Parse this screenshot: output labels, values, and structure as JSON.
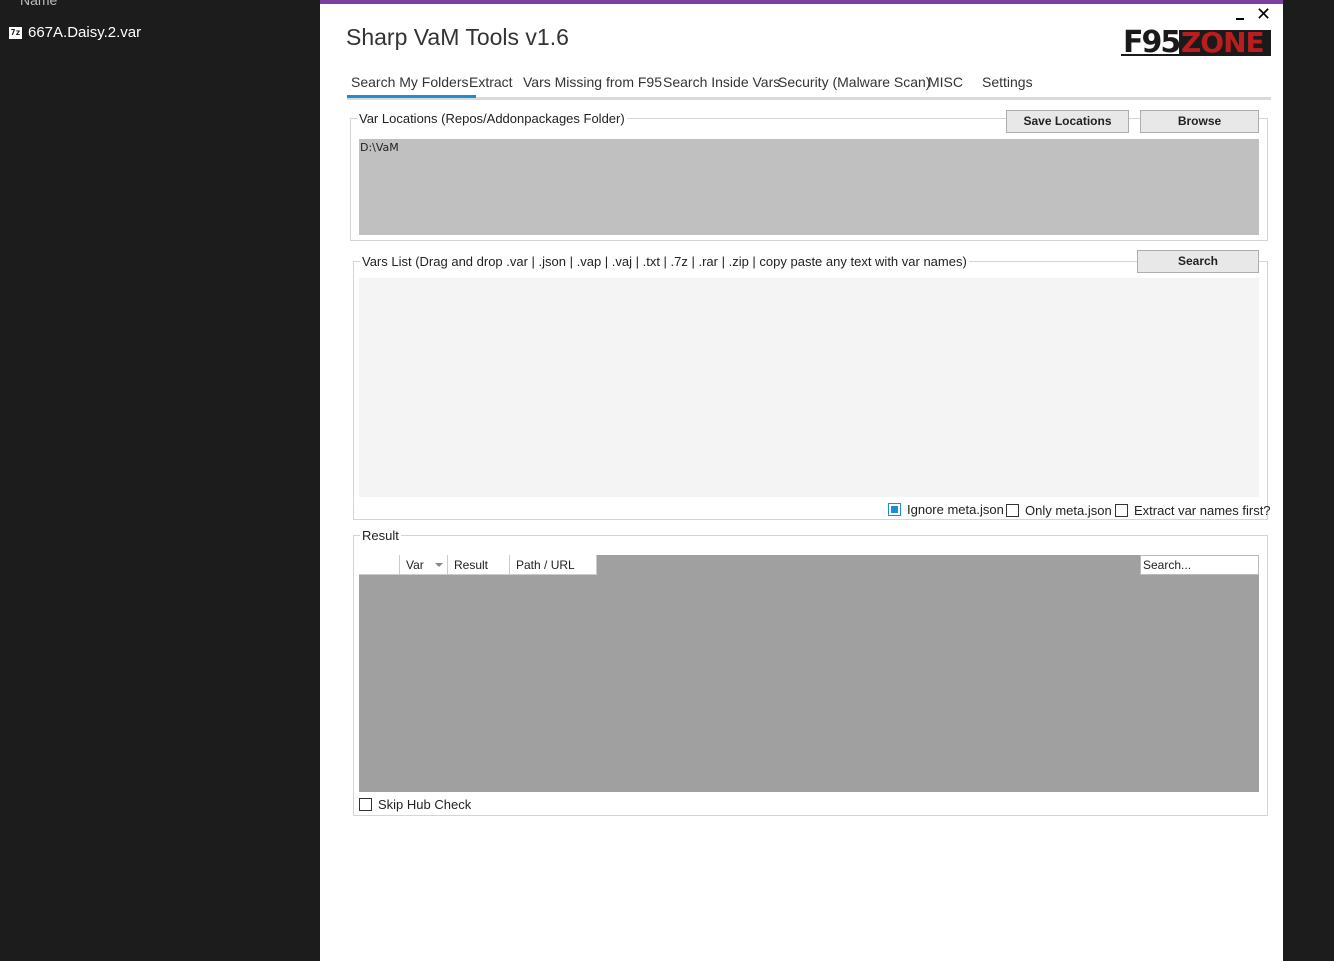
{
  "explorer": {
    "header": "Name",
    "file_name": "667A.Daisy.2.var",
    "file_icon": "7z"
  },
  "app": {
    "title": "Sharp VaM Tools v1.6",
    "accent_color": "#7b3fa0",
    "logo_text_a": "F95",
    "logo_text_b": "ZONE",
    "close_glyph": "✕"
  },
  "tabs": [
    {
      "label": "Search My Folders",
      "active": true
    },
    {
      "label": "Extract"
    },
    {
      "label": "Vars Missing from F95"
    },
    {
      "label": "Search Inside Vars"
    },
    {
      "label": "Security (Malware Scan)"
    },
    {
      "label": "MISC"
    },
    {
      "label": "Settings"
    }
  ],
  "locations": {
    "label": "Var Locations (Repos/Addonpackages Folder)",
    "save_button": "Save Locations",
    "browse_button": "Browse",
    "value": "D:\\VaM"
  },
  "vars_list": {
    "label": "Vars List (Drag and drop .var | .json | .vap | .vaj | .txt | .7z | .rar | .zip | copy paste any text with var names)",
    "search_button": "Search",
    "ignore_meta": "Ignore meta.json",
    "only_meta": "Only meta.json",
    "extract_first": "Extract var names first?"
  },
  "result": {
    "label": "Result",
    "columns": [
      "",
      "Var",
      "Result",
      "Path / URL"
    ],
    "search_placeholder": "Search...",
    "skip_hub": "Skip Hub Check"
  }
}
